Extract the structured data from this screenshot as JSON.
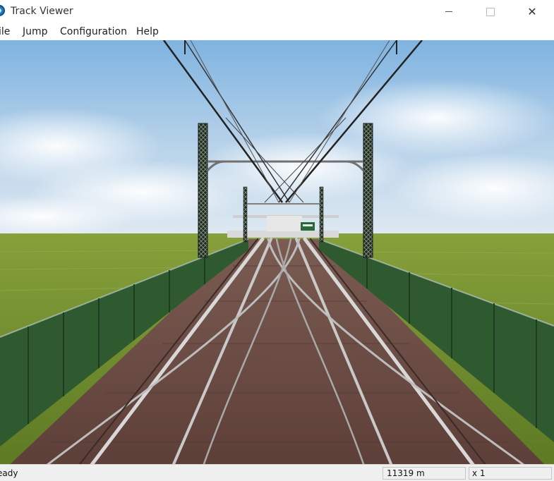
{
  "window": {
    "title": "Track Viewer",
    "icon": "app-globe-icon",
    "controls": {
      "minimize": "minimize-icon",
      "maximize": "maximize-icon",
      "close": "close-icon"
    }
  },
  "menubar": {
    "items": [
      {
        "label": "ile"
      },
      {
        "label": "Jump"
      },
      {
        "label": "Configuration"
      },
      {
        "label": "Help"
      }
    ]
  },
  "statusbar": {
    "status": "eady",
    "distance": "11319 m",
    "speed": "x 1"
  },
  "colors": {
    "sky_top": "#7fb3e0",
    "sky_horizon": "#dfeaf2",
    "grass": "#6f8a2e",
    "bridge_wall": "#2f5a2f",
    "ballast": "#6b4a42",
    "rail": "#b8b8b8"
  }
}
